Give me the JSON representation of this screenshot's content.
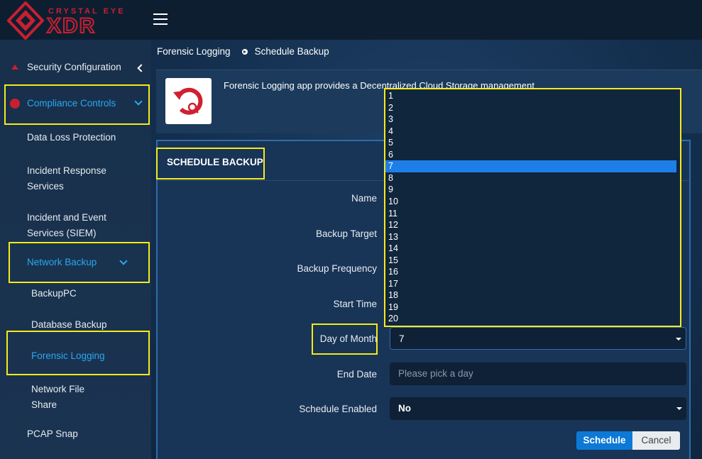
{
  "brand": {
    "line1": "CRYSTAL EYE",
    "line2": "XDR",
    "accent": "#c72030"
  },
  "sidebar": {
    "items": [
      {
        "label": "Security Configuration",
        "icon": "triangle-icon"
      },
      {
        "label": "Compliance Controls",
        "icon": "dot-icon",
        "active": true
      },
      {
        "label": "Data Loss Protection"
      },
      {
        "label": "Incident Response Services"
      },
      {
        "label": "Incident and Event Services (SIEM)"
      },
      {
        "label": "Network Backup",
        "active": true
      },
      {
        "label": "BackupPC"
      },
      {
        "label": "Database Backup"
      },
      {
        "label": "Forensic Logging",
        "active": true
      },
      {
        "label": "Network File Share"
      },
      {
        "label": "PCAP Snap"
      }
    ]
  },
  "breadcrumb": {
    "root": "Forensic Logging",
    "current": "Schedule Backup"
  },
  "info": {
    "text": "Forensic Logging app provides a Decentralized Cloud Storage management"
  },
  "form": {
    "title": "SCHEDULE BACKUP",
    "labels": {
      "name": "Name",
      "backup_target": "Backup Target",
      "backup_frequency": "Backup Frequency",
      "start_time": "Start Time",
      "day_of_month": "Day of Month",
      "end_date": "End Date",
      "schedule_enabled": "Schedule Enabled"
    },
    "values": {
      "day_of_month": "7",
      "end_date_placeholder": "Please pick a day",
      "schedule_enabled": "No"
    },
    "buttons": {
      "schedule": "Schedule",
      "cancel": "Cancel"
    }
  },
  "dropdown": {
    "options": [
      "1",
      "2",
      "3",
      "4",
      "5",
      "6",
      "7",
      "8",
      "9",
      "10",
      "11",
      "12",
      "13",
      "14",
      "15",
      "16",
      "17",
      "18",
      "19",
      "20"
    ],
    "selected": "7"
  },
  "colors": {
    "highlight": "#f5ea1c",
    "active": "#29a8f0",
    "primary_button": "#0d79d6",
    "selected_option": "#1e7ee8"
  }
}
